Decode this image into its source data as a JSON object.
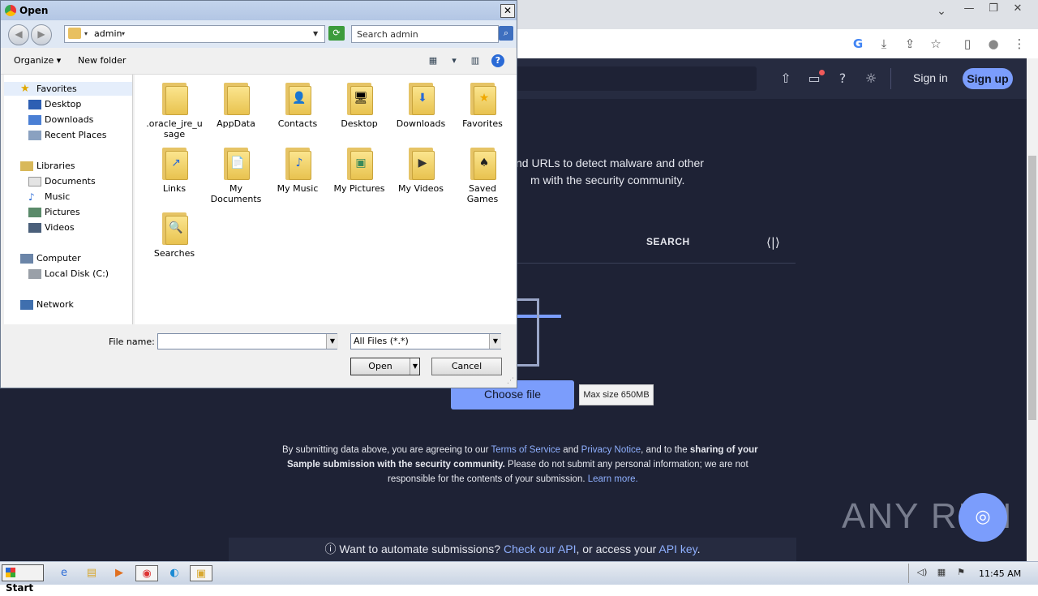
{
  "browser": {
    "window_controls": [
      "—",
      "❐",
      "✕"
    ],
    "toolbar_icons": [
      "G",
      "⤓",
      "⇪",
      "☆",
      "▯",
      "●",
      "⋮"
    ]
  },
  "site": {
    "header": {
      "sign_in": "Sign in",
      "sign_up": "Sign up"
    },
    "intro_line1": "nd URLs to detect malware and other",
    "intro_line2": "m with the security community.",
    "tab_search": "SEARCH",
    "choose_file": "Choose file",
    "max_size": "Max size 650MB",
    "terms": {
      "line1_pre": "By submitting data above, you are agreeing to our ",
      "tos": "Terms of Service",
      "and": " and ",
      "privacy": "Privacy Notice",
      "line1_post": ", and to the ",
      "bold1": "sharing of your",
      "bold2": "Sample submission with the security community.",
      "line2_post": " Please do not submit any personal information; we are not",
      "line3": "responsible for the contents of your submission. ",
      "learn_more": "Learn more."
    },
    "api_bar": {
      "info_icon": "ⓘ",
      "pre": " Want to automate submissions? ",
      "check_api": "Check our API",
      "mid": ", or access your ",
      "api_key": "API key",
      "post": "."
    },
    "watermark": "ANY RUN"
  },
  "dialog": {
    "title": "Open",
    "close": "✕",
    "address": "admin",
    "search_placeholder": "Search admin",
    "organize": "Organize",
    "new_folder": "New folder",
    "help": "?",
    "nav": {
      "favorites": "Favorites",
      "desktop": "Desktop",
      "downloads": "Downloads",
      "recent_places": "Recent Places",
      "libraries": "Libraries",
      "documents": "Documents",
      "music": "Music",
      "pictures": "Pictures",
      "videos": "Videos",
      "computer": "Computer",
      "local_disk": "Local Disk (C:)",
      "network": "Network"
    },
    "files": [
      {
        "label": ".oracle_jre_u\nsage",
        "icon": ""
      },
      {
        "label": "AppData",
        "icon": ""
      },
      {
        "label": "Contacts",
        "icon": "👤"
      },
      {
        "label": "Desktop",
        "icon": "🖥"
      },
      {
        "label": "Downloads",
        "icon": "⬇"
      },
      {
        "label": "Favorites",
        "icon": "★"
      },
      {
        "label": "Links",
        "icon": "↗"
      },
      {
        "label": "My\nDocuments",
        "icon": "📄"
      },
      {
        "label": "My Music",
        "icon": "♪"
      },
      {
        "label": "My Pictures",
        "icon": "▣"
      },
      {
        "label": "My Videos",
        "icon": "▶"
      },
      {
        "label": "Saved\nGames",
        "icon": "♠"
      },
      {
        "label": "Searches",
        "icon": "🔍"
      }
    ],
    "file_name_label": "File name:",
    "file_name_value": "",
    "filter": "All Files (*.*)",
    "open_button": "Open",
    "cancel_button": "Cancel"
  },
  "taskbar": {
    "start": "Start",
    "clock": "11:45 AM"
  }
}
